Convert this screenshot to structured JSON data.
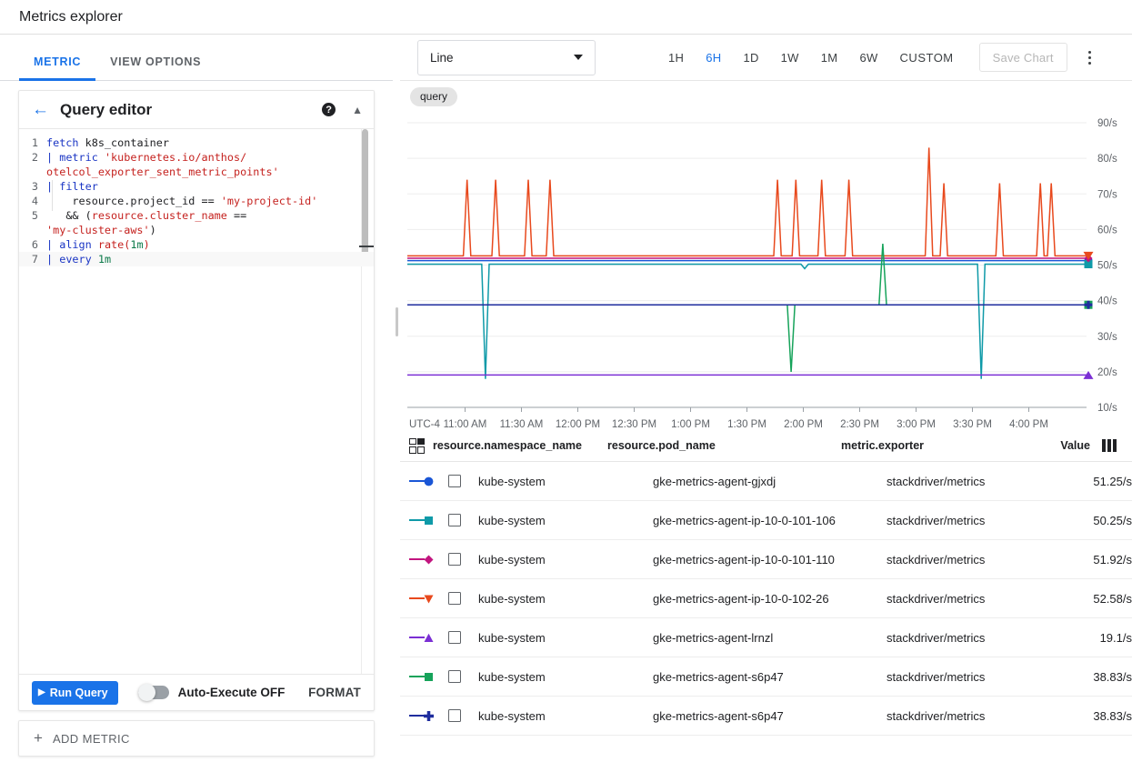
{
  "header": {
    "title": "Metrics explorer"
  },
  "tabs": [
    {
      "label": "METRIC",
      "active": true
    },
    {
      "label": "VIEW OPTIONS",
      "active": false
    }
  ],
  "query_editor": {
    "title": "Query editor",
    "back_icon": "arrow-left-icon",
    "help_icon": "help-icon",
    "help_glyph": "?",
    "collapse_icon": "chevron-up-icon",
    "lines": [
      {
        "num": "1",
        "text": "fetch k8s_container"
      },
      {
        "num": "2",
        "text": "| metric 'kubernetes.io/anthos/otelcol_exporter_sent_metric_points'"
      },
      {
        "num": "3",
        "text": "| filter"
      },
      {
        "num": "4",
        "text": "    resource.project_id == 'my-project-id'"
      },
      {
        "num": "5",
        "text": "   && (resource.cluster_name == 'my-cluster-aws')"
      },
      {
        "num": "6",
        "text": "| align rate(1m)"
      },
      {
        "num": "7",
        "text": "| every 1m"
      }
    ]
  },
  "run_bar": {
    "run_label": "Run Query",
    "run_icon": "play-icon",
    "auto_execute_label": "Auto-Execute OFF",
    "auto_execute_on": false,
    "format_label": "FORMAT"
  },
  "add_metric": {
    "label": "ADD METRIC",
    "icon": "plus-icon"
  },
  "chart_toolbar": {
    "chart_type": "Line",
    "chart_type_icon": "chevron-down-icon",
    "ranges": [
      {
        "label": "1H",
        "active": false
      },
      {
        "label": "6H",
        "active": true
      },
      {
        "label": "1D",
        "active": false
      },
      {
        "label": "1W",
        "active": false
      },
      {
        "label": "1M",
        "active": false
      },
      {
        "label": "6W",
        "active": false
      },
      {
        "label": "CUSTOM",
        "active": false
      }
    ],
    "save_chart_label": "Save Chart",
    "save_chart_disabled": true,
    "more_icon": "kebab-menu-icon"
  },
  "chip": {
    "label": "query"
  },
  "colors": {
    "accent": "#1a73e8",
    "run_button": "#1a73e8",
    "chip_bg": "#e4e4e4",
    "grid": "#eeeeee",
    "axis": "#9aa0a6"
  },
  "chart_data": {
    "type": "line",
    "title": "",
    "xlabel": "",
    "ylabel": "",
    "timezone_label": "UTC-4",
    "grid": true,
    "legend_position": "table-below",
    "ylim": [
      10,
      90
    ],
    "yticks": [
      "10/s",
      "20/s",
      "30/s",
      "40/s",
      "50/s",
      "60/s",
      "70/s",
      "80/s",
      "90/s"
    ],
    "ytick_values": [
      10,
      20,
      30,
      40,
      50,
      60,
      70,
      80,
      90
    ],
    "xticks": [
      "11:00 AM",
      "11:30 AM",
      "12:00 PM",
      "12:30 PM",
      "1:00 PM",
      "1:30 PM",
      "2:00 PM",
      "2:30 PM",
      "3:00 PM",
      "3:30 PM",
      "4:00 PM"
    ],
    "series": [
      {
        "name": "gke-metrics-agent-gjxdj",
        "color": "#1a56d6",
        "marker": "circle",
        "baseline": 51.25,
        "end_value": 51.25,
        "spikes": []
      },
      {
        "name": "gke-metrics-agent-ip-10-0-101-106",
        "color": "#0f9aa8",
        "marker": "square",
        "baseline": 50.25,
        "end_value": 50.25,
        "spikes": [
          {
            "x": 0.115,
            "to": 18
          },
          {
            "x": 0.585,
            "to": 49
          },
          {
            "x": 0.845,
            "to": 18
          }
        ]
      },
      {
        "name": "gke-metrics-agent-ip-10-0-101-110",
        "color": "#c2157f",
        "marker": "diamond",
        "baseline": 51.92,
        "end_value": 51.92,
        "spikes": []
      },
      {
        "name": "gke-metrics-agent-ip-10-0-102-26",
        "color": "#e8491d",
        "marker": "triangle-down",
        "baseline": 52.58,
        "end_value": 52.58,
        "spikes": [
          {
            "x": 0.088,
            "to": 74
          },
          {
            "x": 0.13,
            "to": 74
          },
          {
            "x": 0.178,
            "to": 74
          },
          {
            "x": 0.21,
            "to": 74
          },
          {
            "x": 0.545,
            "to": 74
          },
          {
            "x": 0.572,
            "to": 74
          },
          {
            "x": 0.61,
            "to": 74
          },
          {
            "x": 0.65,
            "to": 74
          },
          {
            "x": 0.768,
            "to": 83
          },
          {
            "x": 0.79,
            "to": 73
          },
          {
            "x": 0.872,
            "to": 73
          },
          {
            "x": 0.932,
            "to": 73
          },
          {
            "x": 0.948,
            "to": 73
          }
        ]
      },
      {
        "name": "gke-metrics-agent-lrnzl",
        "color": "#7b2fd4",
        "marker": "triangle-up",
        "baseline": 19.1,
        "end_value": 19.1,
        "spikes": []
      },
      {
        "name": "gke-metrics-agent-s6p47",
        "color": "#16a35a",
        "marker": "square",
        "baseline": 38.83,
        "end_value": 38.83,
        "spikes": [
          {
            "x": 0.565,
            "to": 20
          },
          {
            "x": 0.7,
            "to": 56
          }
        ]
      },
      {
        "name": "gke-metrics-agent-s6p47",
        "color": "#1f2d9e",
        "marker": "plus",
        "baseline": 38.83,
        "end_value": 38.83,
        "spikes": []
      }
    ]
  },
  "table": {
    "columns_icon": "select-columns-icon",
    "value_bars_icon": "value-bars-icon",
    "headers": {
      "namespace": "resource.namespace_name",
      "pod": "resource.pod_name",
      "exporter": "metric.exporter",
      "value": "Value"
    },
    "rows": [
      {
        "marker": "circle",
        "color": "#1a56d6",
        "namespace": "kube-system",
        "pod": "gke-metrics-agent-gjxdj",
        "exporter": "stackdriver/metrics",
        "value": "51.25/s"
      },
      {
        "marker": "square",
        "color": "#0f9aa8",
        "namespace": "kube-system",
        "pod": "gke-metrics-agent-ip-10-0-101-106",
        "exporter": "stackdriver/metrics",
        "value": "50.25/s"
      },
      {
        "marker": "diamond",
        "color": "#c2157f",
        "namespace": "kube-system",
        "pod": "gke-metrics-agent-ip-10-0-101-110",
        "exporter": "stackdriver/metrics",
        "value": "51.92/s"
      },
      {
        "marker": "triangle-down",
        "color": "#e8491d",
        "namespace": "kube-system",
        "pod": "gke-metrics-agent-ip-10-0-102-26",
        "exporter": "stackdriver/metrics",
        "value": "52.58/s"
      },
      {
        "marker": "triangle-up",
        "color": "#7b2fd4",
        "namespace": "kube-system",
        "pod": "gke-metrics-agent-lrnzl",
        "exporter": "stackdriver/metrics",
        "value": "19.1/s"
      },
      {
        "marker": "square",
        "color": "#16a35a",
        "namespace": "kube-system",
        "pod": "gke-metrics-agent-s6p47",
        "exporter": "stackdriver/metrics",
        "value": "38.83/s"
      },
      {
        "marker": "plus",
        "color": "#1f2d9e",
        "namespace": "kube-system",
        "pod": "gke-metrics-agent-s6p47",
        "exporter": "stackdriver/metrics",
        "value": "38.83/s"
      }
    ]
  }
}
